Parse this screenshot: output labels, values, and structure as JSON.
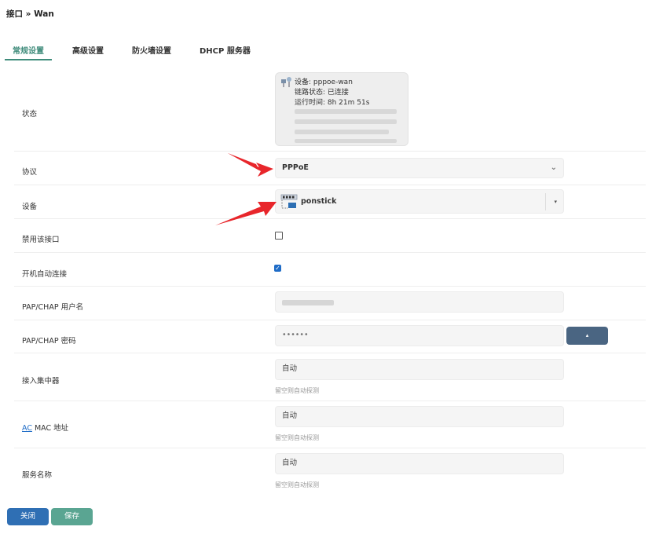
{
  "breadcrumb": "接口 » Wan",
  "tabs": [
    {
      "label": "常规设置"
    },
    {
      "label": "高级设置"
    },
    {
      "label": "防火墙设置"
    },
    {
      "label": "DHCP 服务器"
    }
  ],
  "status": {
    "label": "状态",
    "device_line": "设备: pppoe-wan",
    "link_line": "链路状态: 已连接",
    "uptime_line": "运行时间: 8h 21m 51s"
  },
  "protocol": {
    "label": "协议",
    "value": "PPPoE"
  },
  "device": {
    "label": "设备",
    "value": "ponstick"
  },
  "disable_iface": {
    "label": "禁用该接口",
    "checked": false
  },
  "auto_connect": {
    "label": "开机自动连接",
    "checked": true
  },
  "pap_user": {
    "label": "PAP/CHAP 用户名"
  },
  "pap_pass": {
    "label": "PAP/CHAP 密码",
    "value": "••••••"
  },
  "concentrator": {
    "label": "接入集中器",
    "placeholder": "自动",
    "hint": "留空则自动探测"
  },
  "ac_mac": {
    "label_abbr": "AC",
    "label_rest": " MAC 地址",
    "placeholder": "自动",
    "hint": "留空则自动探测"
  },
  "service_name": {
    "label": "服务名称",
    "placeholder": "自动",
    "hint": "留空则自动探测"
  },
  "buttons": {
    "close": "关闭",
    "save": "保存"
  },
  "colors": {
    "accent": "#3e8b7a",
    "primary": "#2f6fb4",
    "arrow": "#e8262b",
    "pass_toggle": "#4a6582"
  }
}
